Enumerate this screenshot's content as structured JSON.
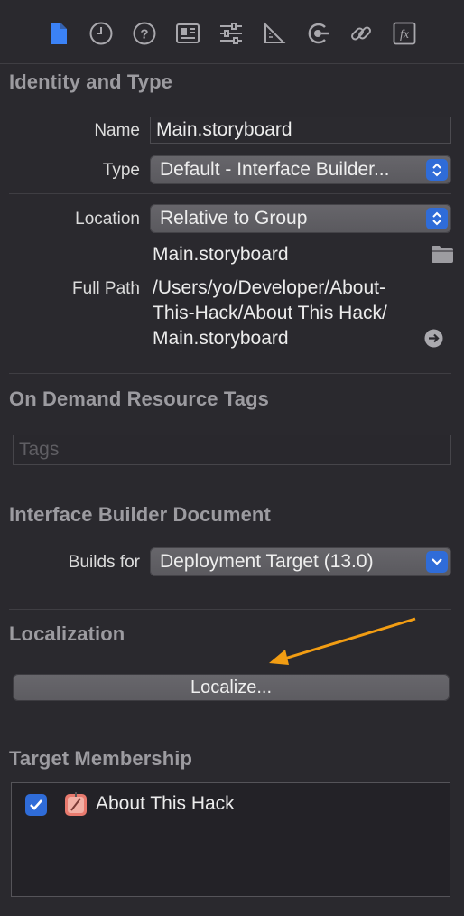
{
  "toolbar": {
    "icons": [
      "file-inspector-icon",
      "history-icon",
      "help-icon",
      "identity-icon",
      "attributes-icon",
      "size-icon",
      "connections-icon",
      "bindings-icon",
      "effects-icon"
    ],
    "effects_glyph": "fx"
  },
  "identity": {
    "title": "Identity and Type",
    "name_label": "Name",
    "name_value": "Main.storyboard",
    "type_label": "Type",
    "type_value": "Default - Interface Builder...",
    "location_label": "Location",
    "location_value": "Relative to Group",
    "file_name": "Main.storyboard",
    "full_path_label": "Full Path",
    "full_path_lines": [
      "/Users/yo/Developer/About-",
      "This-Hack/About This Hack/",
      "Main.storyboard"
    ]
  },
  "odr": {
    "title": "On Demand Resource Tags",
    "tags_placeholder": "Tags"
  },
  "ib_document": {
    "title": "Interface Builder Document",
    "builds_for_label": "Builds for",
    "builds_for_value": "Deployment Target (13.0)"
  },
  "localization": {
    "title": "Localization",
    "localize_button": "Localize..."
  },
  "target_membership": {
    "title": "Target Membership",
    "targets": [
      {
        "name": "About This Hack",
        "checked": true
      }
    ]
  },
  "colors": {
    "accent": "#2f6cd8",
    "active_icon": "#3b82f6",
    "annotation_arrow": "#f29d13"
  }
}
